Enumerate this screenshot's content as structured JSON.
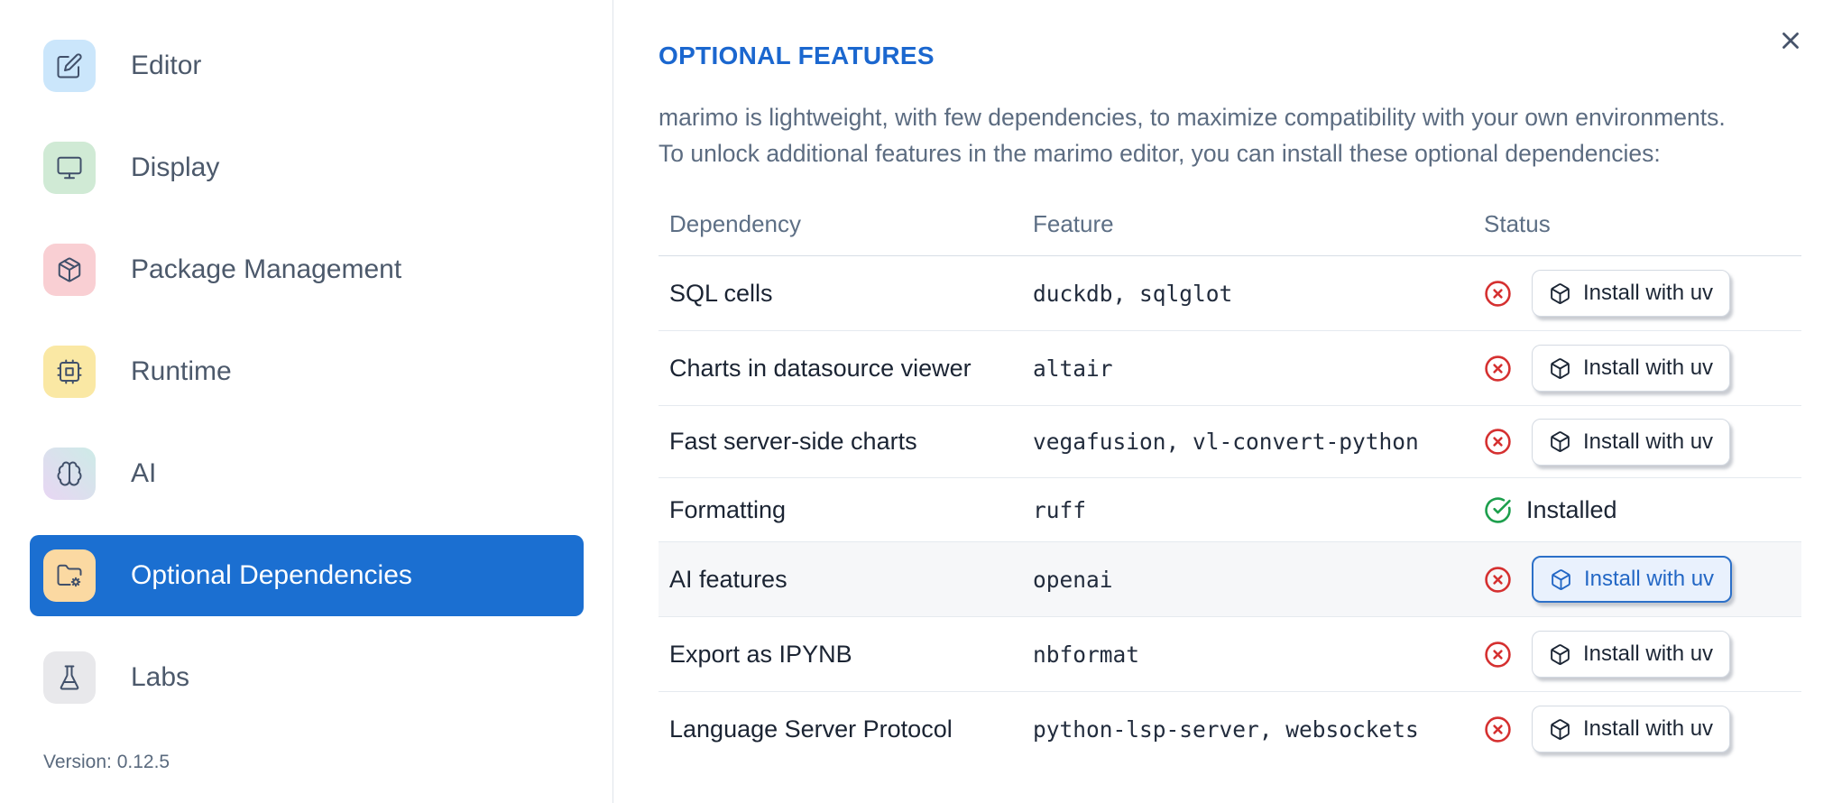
{
  "sidebar": {
    "items": [
      {
        "label": "Editor",
        "icon": "edit-icon",
        "icon_bg": "#cbe6fb",
        "selected": false
      },
      {
        "label": "Display",
        "icon": "monitor-icon",
        "icon_bg": "#d0ead5",
        "selected": false
      },
      {
        "label": "Package Management",
        "icon": "package-icon",
        "icon_bg": "#f9cfd3",
        "selected": false
      },
      {
        "label": "Runtime",
        "icon": "cpu-icon",
        "icon_bg": "#fae8a4",
        "selected": false
      },
      {
        "label": "AI",
        "icon": "brain-icon",
        "icon_bg_gradient": [
          "#cdebe7",
          "#e8d6f3"
        ],
        "selected": false
      },
      {
        "label": "Optional Dependencies",
        "icon": "folder-cog-icon",
        "icon_bg": "#fbd9a2",
        "selected": true
      },
      {
        "label": "Labs",
        "icon": "flask-icon",
        "icon_bg": "#e8e8eb",
        "selected": false
      }
    ],
    "version": "Version: 0.12.5"
  },
  "panel": {
    "title": "OPTIONAL FEATURES",
    "close_icon": "x-icon",
    "description_line1": "marimo is lightweight, with few dependencies, to maximize compatibility with your own environments.",
    "description_line2": "To unlock additional features in the marimo editor, you can install these optional dependencies:",
    "table": {
      "headers": [
        "Dependency",
        "Feature",
        "Status"
      ],
      "rows": [
        {
          "dependency": "SQL cells",
          "feature": "duckdb, sqlglot",
          "status": "missing",
          "action": "Install with uv",
          "highlighted": false
        },
        {
          "dependency": "Charts in datasource viewer",
          "feature": "altair",
          "status": "missing",
          "action": "Install with uv",
          "highlighted": false
        },
        {
          "dependency": "Fast server-side charts",
          "feature": "vegafusion, vl-convert-python",
          "status": "missing",
          "action": "Install with uv",
          "highlighted": false
        },
        {
          "dependency": "Formatting",
          "feature": "ruff",
          "status": "installed",
          "status_label": "Installed",
          "highlighted": false
        },
        {
          "dependency": "AI features",
          "feature": "openai",
          "status": "missing",
          "action": "Install with uv",
          "highlighted": true
        },
        {
          "dependency": "Export as IPYNB",
          "feature": "nbformat",
          "status": "missing",
          "action": "Install with uv",
          "highlighted": false
        },
        {
          "dependency": "Language Server Protocol",
          "feature": "python-lsp-server, websockets",
          "status": "missing",
          "action": "Install with uv",
          "highlighted": false
        }
      ]
    }
  },
  "colors": {
    "accent_blue": "#1b6fd1",
    "title_blue": "#1b67cf",
    "error_red": "#d53030",
    "success_green": "#1d9f4d",
    "row_highlight_bg": "#f6f7f9",
    "button_highlight_bg": "#e9f1fd",
    "button_highlight_border": "#2c70c8",
    "button_highlight_text": "#2367c5"
  }
}
